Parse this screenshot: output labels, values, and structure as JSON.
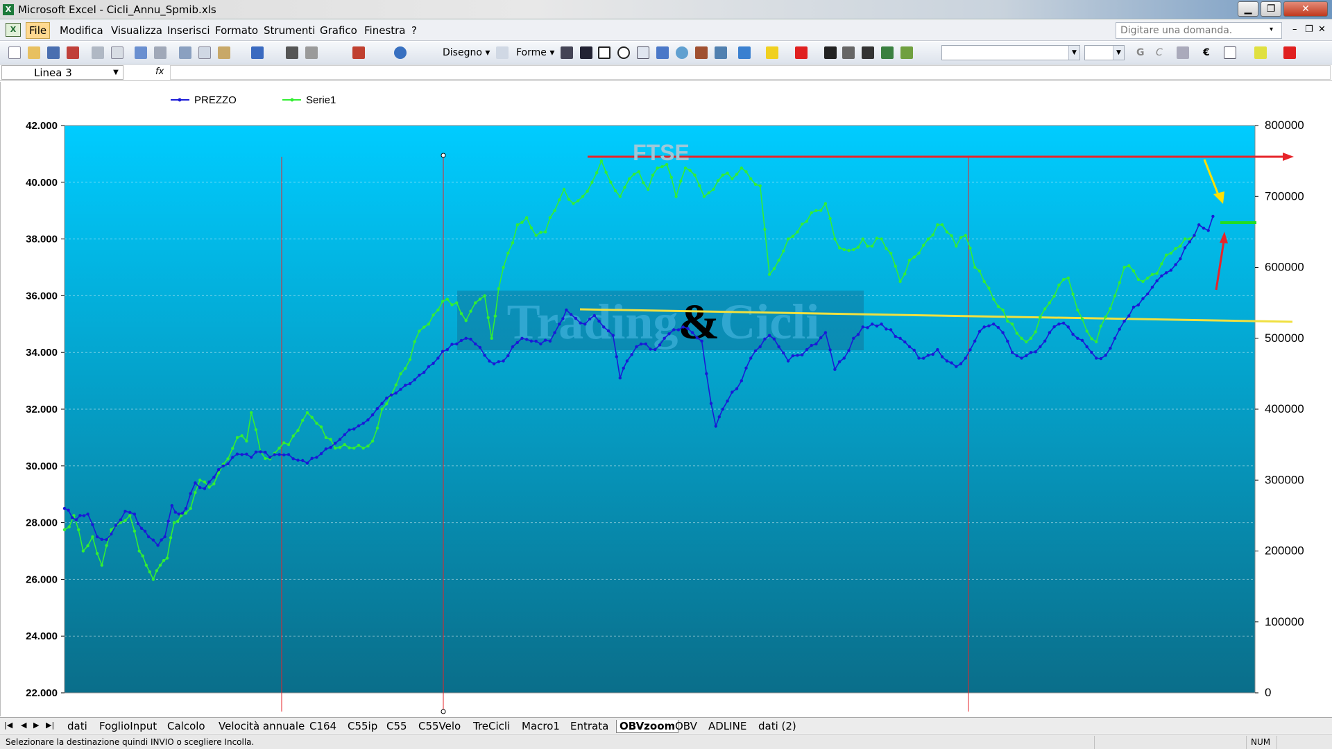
{
  "window": {
    "app_icon": "X",
    "title": "Microsoft Excel - Cicli_Annu_Spmib.xls",
    "min": "▁",
    "max": "❐",
    "close": "✕"
  },
  "menu": {
    "items": [
      "File",
      "Modifica",
      "Visualizza",
      "Inserisci",
      "Formato",
      "Strumenti",
      "Grafico",
      "Finestra",
      "?"
    ],
    "help_placeholder": "Digitare una domanda.",
    "mdi_controls": [
      "▾",
      "–",
      "❐",
      "✕"
    ]
  },
  "toolbar": {
    "disegno": "Disegno ▾",
    "forme": "Forme ▾",
    "bold": "G",
    "italic": "C",
    "euro": "€"
  },
  "formula_bar": {
    "name_box": "Linea 3",
    "fx": "fx"
  },
  "chart": {
    "legend": [
      "PREZZO",
      "Serie1"
    ],
    "watermark": "Trading&Cicli",
    "watermark_left": "Trading",
    "watermark_amp": "&",
    "watermark_right": "Cicli",
    "annotation": "FTSE",
    "colors": {
      "plot_top": "#00ccff",
      "plot_bottom": "#0a6e8a",
      "prezzo": "#1a1ad6",
      "serie1": "#33ee33",
      "red_line": "#e6242a",
      "yellow_line": "#f0e040",
      "yellow_arrow": "#ffe000",
      "green_stub": "#22dd22"
    }
  },
  "chart_data": {
    "type": "line",
    "title": "",
    "y_left": {
      "ticks": [
        "42.000",
        "40.000",
        "38.000",
        "36.000",
        "34.000",
        "32.000",
        "30.000",
        "28.000",
        "26.000",
        "24.000",
        "22.000"
      ],
      "range": [
        22000,
        42000
      ]
    },
    "y_right": {
      "ticks": [
        "800000",
        "700000",
        "600000",
        "500000",
        "400000",
        "300000",
        "200000",
        "100000",
        "0"
      ],
      "range": [
        0,
        800000
      ]
    },
    "x_points": 255,
    "grid": true,
    "legend_position": "top-left",
    "series": [
      {
        "name": "PREZZO",
        "axis": "left",
        "anchors": [
          [
            0,
            28500
          ],
          [
            5,
            28100
          ],
          [
            10,
            28300
          ],
          [
            14,
            27500
          ],
          [
            18,
            27400
          ],
          [
            22,
            27900
          ],
          [
            26,
            28400
          ],
          [
            30,
            28300
          ],
          [
            33,
            27800
          ],
          [
            36,
            27500
          ],
          [
            40,
            27200
          ],
          [
            43,
            27500
          ],
          [
            46,
            28600
          ],
          [
            49,
            28300
          ],
          [
            52,
            28500
          ],
          [
            56,
            29400
          ],
          [
            60,
            29200
          ],
          [
            64,
            29600
          ],
          [
            68,
            30000
          ],
          [
            72,
            30300
          ],
          [
            76,
            30400
          ],
          [
            80,
            30300
          ],
          [
            84,
            30500
          ],
          [
            88,
            30300
          ],
          [
            92,
            30400
          ],
          [
            96,
            30400
          ],
          [
            100,
            30200
          ],
          [
            104,
            30100
          ],
          [
            108,
            30300
          ],
          [
            112,
            30600
          ],
          [
            116,
            30800
          ],
          [
            120,
            31100
          ],
          [
            124,
            31300
          ],
          [
            128,
            31500
          ],
          [
            132,
            31800
          ],
          [
            136,
            32200
          ],
          [
            140,
            32500
          ],
          [
            144,
            32700
          ],
          [
            148,
            32900
          ],
          [
            152,
            33200
          ],
          [
            156,
            33500
          ],
          [
            160,
            33800
          ],
          [
            164,
            34100
          ],
          [
            168,
            34300
          ],
          [
            172,
            34500
          ],
          [
            176,
            34300
          ],
          [
            180,
            33900
          ],
          [
            184,
            33600
          ],
          [
            188,
            33700
          ],
          [
            192,
            34200
          ],
          [
            196,
            34500
          ],
          [
            200,
            34400
          ],
          [
            204,
            34300
          ],
          [
            208,
            34400
          ],
          [
            212,
            35000
          ],
          [
            215,
            35500
          ],
          [
            219,
            35200
          ],
          [
            223,
            35000
          ],
          [
            227,
            35300
          ],
          [
            231,
            34900
          ],
          [
            235,
            34600
          ],
          [
            238,
            33100
          ],
          [
            241,
            33700
          ],
          [
            245,
            34200
          ],
          [
            249,
            34300
          ],
          [
            253,
            34100
          ],
          [
            257,
            34500
          ],
          [
            261,
            34800
          ],
          [
            265,
            34900
          ],
          [
            269,
            34700
          ],
          [
            273,
            34400
          ],
          [
            277,
            32200
          ],
          [
            279,
            31400
          ],
          [
            282,
            32000
          ],
          [
            286,
            32600
          ],
          [
            290,
            33000
          ],
          [
            294,
            33800
          ],
          [
            298,
            34200
          ],
          [
            302,
            34600
          ],
          [
            306,
            34200
          ],
          [
            310,
            33700
          ],
          [
            314,
            33900
          ],
          [
            318,
            34100
          ],
          [
            322,
            34300
          ],
          [
            326,
            34700
          ],
          [
            330,
            33400
          ],
          [
            334,
            33800
          ],
          [
            338,
            34500
          ],
          [
            342,
            34900
          ],
          [
            346,
            35000
          ],
          [
            350,
            35000
          ],
          [
            354,
            34800
          ],
          [
            358,
            34500
          ],
          [
            362,
            34200
          ],
          [
            366,
            33800
          ],
          [
            370,
            33900
          ],
          [
            374,
            34100
          ],
          [
            378,
            33700
          ],
          [
            382,
            33500
          ],
          [
            386,
            33800
          ],
          [
            390,
            34400
          ],
          [
            394,
            34900
          ],
          [
            398,
            35000
          ],
          [
            402,
            34700
          ],
          [
            406,
            34000
          ],
          [
            410,
            33800
          ],
          [
            414,
            34000
          ],
          [
            418,
            34200
          ],
          [
            422,
            34700
          ],
          [
            426,
            35000
          ],
          [
            430,
            34900
          ],
          [
            434,
            34500
          ],
          [
            438,
            34200
          ],
          [
            442,
            33800
          ],
          [
            446,
            33900
          ],
          [
            450,
            34500
          ],
          [
            454,
            35100
          ],
          [
            458,
            35600
          ],
          [
            462,
            35900
          ],
          [
            466,
            36300
          ],
          [
            470,
            36700
          ],
          [
            474,
            36900
          ],
          [
            478,
            37300
          ],
          [
            482,
            37900
          ],
          [
            486,
            38500
          ],
          [
            490,
            38300
          ],
          [
            492,
            38800
          ]
        ]
      },
      {
        "name": "Serie1",
        "axis": "right",
        "anchors": [
          [
            0,
            230000
          ],
          [
            4,
            250000
          ],
          [
            8,
            200000
          ],
          [
            12,
            220000
          ],
          [
            16,
            180000
          ],
          [
            20,
            230000
          ],
          [
            24,
            240000
          ],
          [
            28,
            250000
          ],
          [
            32,
            200000
          ],
          [
            35,
            180000
          ],
          [
            38,
            160000
          ],
          [
            41,
            180000
          ],
          [
            44,
            190000
          ],
          [
            47,
            240000
          ],
          [
            50,
            250000
          ],
          [
            54,
            260000
          ],
          [
            58,
            300000
          ],
          [
            62,
            290000
          ],
          [
            66,
            310000
          ],
          [
            70,
            330000
          ],
          [
            74,
            360000
          ],
          [
            78,
            355000
          ],
          [
            80,
            395000
          ],
          [
            84,
            340000
          ],
          [
            88,
            330000
          ],
          [
            92,
            345000
          ],
          [
            96,
            350000
          ],
          [
            100,
            370000
          ],
          [
            104,
            395000
          ],
          [
            108,
            380000
          ],
          [
            112,
            360000
          ],
          [
            116,
            345000
          ],
          [
            120,
            350000
          ],
          [
            124,
            345000
          ],
          [
            128,
            345000
          ],
          [
            132,
            355000
          ],
          [
            136,
            400000
          ],
          [
            140,
            420000
          ],
          [
            144,
            450000
          ],
          [
            148,
            470000
          ],
          [
            152,
            510000
          ],
          [
            156,
            520000
          ],
          [
            160,
            540000
          ],
          [
            164,
            555000
          ],
          [
            168,
            550000
          ],
          [
            172,
            525000
          ],
          [
            176,
            550000
          ],
          [
            180,
            560000
          ],
          [
            183,
            500000
          ],
          [
            186,
            570000
          ],
          [
            190,
            620000
          ],
          [
            194,
            660000
          ],
          [
            198,
            670000
          ],
          [
            202,
            645000
          ],
          [
            206,
            650000
          ],
          [
            210,
            680000
          ],
          [
            214,
            710000
          ],
          [
            218,
            690000
          ],
          [
            222,
            700000
          ],
          [
            226,
            720000
          ],
          [
            230,
            750000
          ],
          [
            234,
            720000
          ],
          [
            238,
            700000
          ],
          [
            242,
            725000
          ],
          [
            246,
            735000
          ],
          [
            250,
            710000
          ],
          [
            254,
            740000
          ],
          [
            258,
            745000
          ],
          [
            262,
            700000
          ],
          [
            266,
            740000
          ],
          [
            270,
            730000
          ],
          [
            274,
            700000
          ],
          [
            278,
            710000
          ],
          [
            282,
            730000
          ],
          [
            286,
            725000
          ],
          [
            290,
            740000
          ],
          [
            294,
            725000
          ],
          [
            298,
            715000
          ],
          [
            302,
            590000
          ],
          [
            306,
            610000
          ],
          [
            310,
            640000
          ],
          [
            314,
            650000
          ],
          [
            318,
            665000
          ],
          [
            322,
            680000
          ],
          [
            326,
            690000
          ],
          [
            330,
            640000
          ],
          [
            334,
            625000
          ],
          [
            338,
            625000
          ],
          [
            342,
            640000
          ],
          [
            346,
            630000
          ],
          [
            350,
            640000
          ],
          [
            354,
            620000
          ],
          [
            358,
            580000
          ],
          [
            362,
            610000
          ],
          [
            366,
            620000
          ],
          [
            370,
            640000
          ],
          [
            374,
            660000
          ],
          [
            378,
            650000
          ],
          [
            382,
            630000
          ],
          [
            386,
            645000
          ],
          [
            390,
            600000
          ],
          [
            394,
            580000
          ],
          [
            398,
            555000
          ],
          [
            402,
            540000
          ],
          [
            406,
            520000
          ],
          [
            410,
            500000
          ],
          [
            414,
            500000
          ],
          [
            418,
            530000
          ],
          [
            422,
            550000
          ],
          [
            426,
            575000
          ],
          [
            430,
            585000
          ],
          [
            434,
            540000
          ],
          [
            438,
            510000
          ],
          [
            442,
            495000
          ],
          [
            446,
            530000
          ],
          [
            450,
            560000
          ],
          [
            454,
            600000
          ],
          [
            458,
            595000
          ],
          [
            462,
            580000
          ],
          [
            466,
            590000
          ],
          [
            470,
            605000
          ],
          [
            474,
            620000
          ],
          [
            478,
            630000
          ],
          [
            482,
            640000
          ],
          [
            486,
            660000
          ]
        ]
      }
    ],
    "x_range": [
      0,
      510
    ]
  },
  "sheet_tabs": {
    "nav": [
      "|◀",
      "◀",
      "▶",
      "▶|"
    ],
    "tabs": [
      "dati",
      "FoglioInput",
      "Calcolo",
      "Velocità annuale",
      "C164",
      "C55ip",
      "C55",
      "C55Velo",
      "TreCicli",
      "Macro1",
      "Entrata",
      "OBVzoom",
      "OBV",
      "ADLINE",
      "dati (2)"
    ],
    "active": "OBVzoom"
  },
  "status": {
    "text": "Selezionare la destinazione quindi INVIO o scegliere Incolla.",
    "num": "NUM"
  }
}
